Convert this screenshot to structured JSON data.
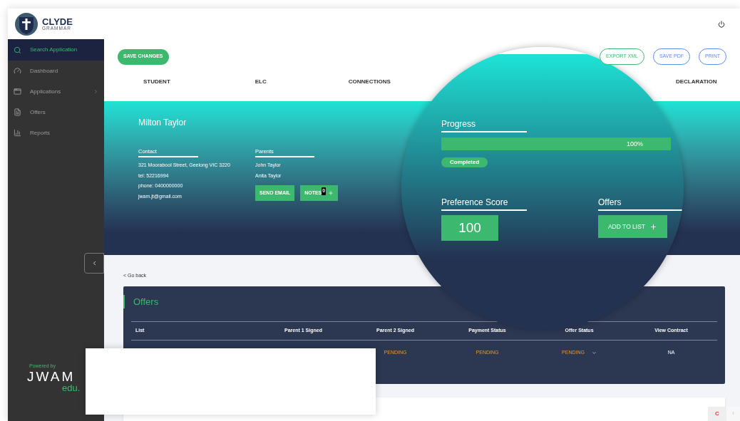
{
  "brand": {
    "name": "CLYDE",
    "subtitle": "GRAMMAR"
  },
  "sidebar": {
    "items": [
      {
        "label": "Search Application",
        "kind": "link",
        "selected": true
      },
      {
        "label": "Dashboard",
        "kind": "link",
        "selected": false
      },
      {
        "label": "Applications",
        "kind": "group",
        "selected": false
      },
      {
        "label": "Offers",
        "kind": "link",
        "selected": false
      },
      {
        "label": "Reports",
        "kind": "link",
        "selected": false
      }
    ],
    "powered_by": "Powered by",
    "logo_main": "JWAM",
    "logo_sub": "edu."
  },
  "toolbar": {
    "save": "SAVE CHANGES",
    "actions": [
      {
        "label": "EXPORT XML",
        "kind": "green"
      },
      {
        "label": "SAVE PDF",
        "kind": "blue"
      },
      {
        "label": "PRINT",
        "kind": "blue"
      }
    ]
  },
  "tabs": [
    {
      "label": "STUDENT"
    },
    {
      "label": "ELC"
    },
    {
      "label": "CONNECTIONS"
    },
    {
      "label": "DECLARATION"
    }
  ],
  "student": {
    "name": "Milton Taylor",
    "contact_heading": "Contact",
    "contact_lines": [
      "321 Moorabool Street, Geelong VIC 3220",
      "tel: 52216994",
      "phone: 0400000000",
      "jwam.jt@gmail.com"
    ],
    "parents_heading": "Parents",
    "parents": [
      "John Taylor",
      "Anita Taylor"
    ],
    "send_email": "SEND EMAIL",
    "notes": {
      "label": "NOTES",
      "count": "0"
    }
  },
  "magnifier": {
    "progress_heading": "Progress",
    "progress": {
      "level": 1,
      "reading": "100%"
    },
    "status": "Completed",
    "score_heading": "Preference Score",
    "score": "100",
    "offers_heading": "Offers",
    "add_to_list": "ADD TO LIST"
  },
  "go_back": "< Go back",
  "offers": {
    "title": "Offers",
    "columns": [
      "List",
      "Parent 1 Signed",
      "Parent 2 Signed",
      "Payment Status",
      "Offer Status",
      "View Contract"
    ],
    "rows": [
      {
        "cells": [
          {
            "text": "",
            "kind": "covered"
          },
          {
            "text": "",
            "kind": "covered"
          },
          {
            "text": "PENDING",
            "kind": "pending"
          },
          {
            "text": "PENDING",
            "kind": "pending"
          },
          {
            "text": "PENDING",
            "kind": "select"
          },
          {
            "text": "NA",
            "kind": "plain"
          }
        ]
      }
    ]
  },
  "widget": {
    "letter": "C",
    "arrow": "‹"
  }
}
